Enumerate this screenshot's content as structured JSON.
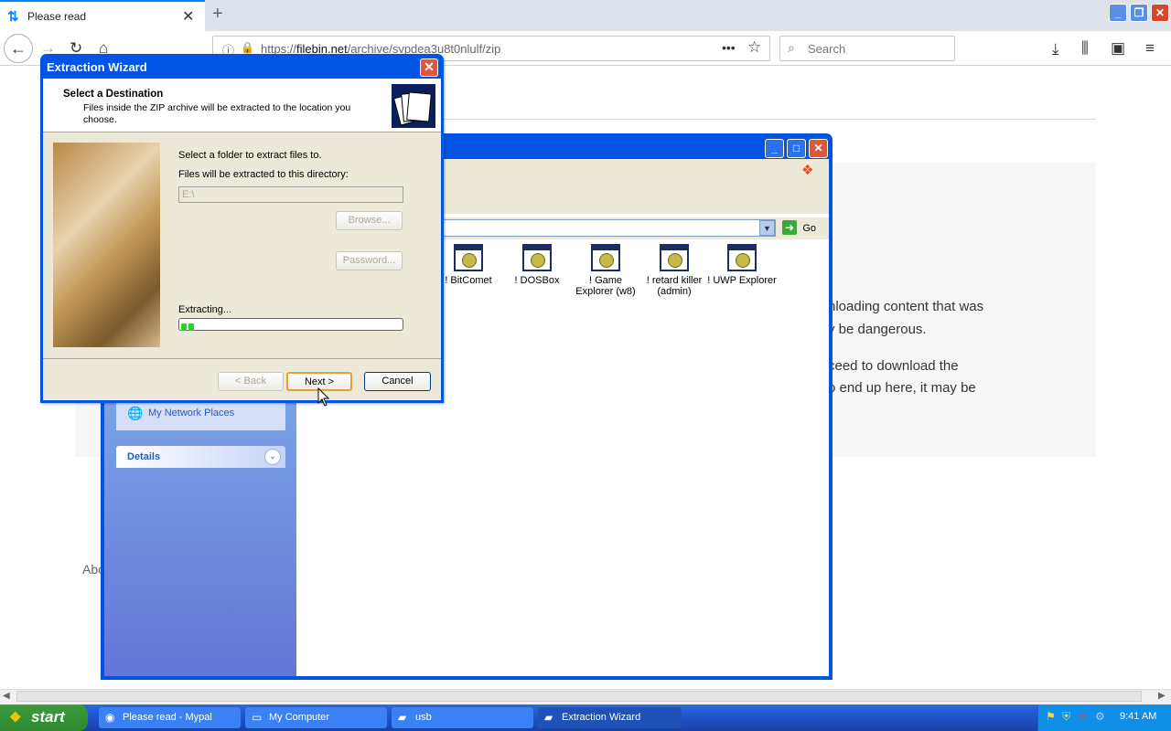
{
  "browser": {
    "tab_title": "Please read",
    "tab_icon": "⇅",
    "url_prefix": "https://",
    "url_domain": "filebin.net",
    "url_path": "/archive/svpdea3u8t0nlulf/zip",
    "search_placeholder": "Search",
    "url_menu": "•••",
    "star": "☆"
  },
  "page": {
    "line1": "nloading content that was",
    "line2": "y be dangerous.",
    "line3": "ceed to download the",
    "line4": "o end up here, it may be",
    "footer_fragment": "Abo"
  },
  "explorer": {
    "go_label": "Go",
    "files": [
      {
        "label": "! BitComet"
      },
      {
        "label": "! DOSBox"
      },
      {
        "label": "! Game Explorer (w8)"
      },
      {
        "label": "! retard killer (admin)"
      },
      {
        "label": "! UWP Explorer"
      }
    ],
    "sidebar": {
      "network": "My Network Places",
      "details": "Details"
    }
  },
  "wizard": {
    "title": "Extraction Wizard",
    "heading": "Select a Destination",
    "subheading": "Files inside the ZIP archive will be extracted to the location you choose.",
    "select_folder": "Select a folder to extract files to.",
    "dir_label": "Files will be extracted to this directory:",
    "dir_value": "E:\\",
    "browse": "Browse...",
    "password": "Password...",
    "extracting": "Extracting...",
    "progress_fraction": 0.05,
    "back": "< Back",
    "next": "Next >",
    "cancel": "Cancel"
  },
  "taskbar": {
    "start": "start",
    "items": [
      {
        "label": "Please read - Mypal"
      },
      {
        "label": "My Computer"
      },
      {
        "label": "usb"
      },
      {
        "label": "Extraction Wizard"
      }
    ],
    "clock": "9:41 AM"
  }
}
